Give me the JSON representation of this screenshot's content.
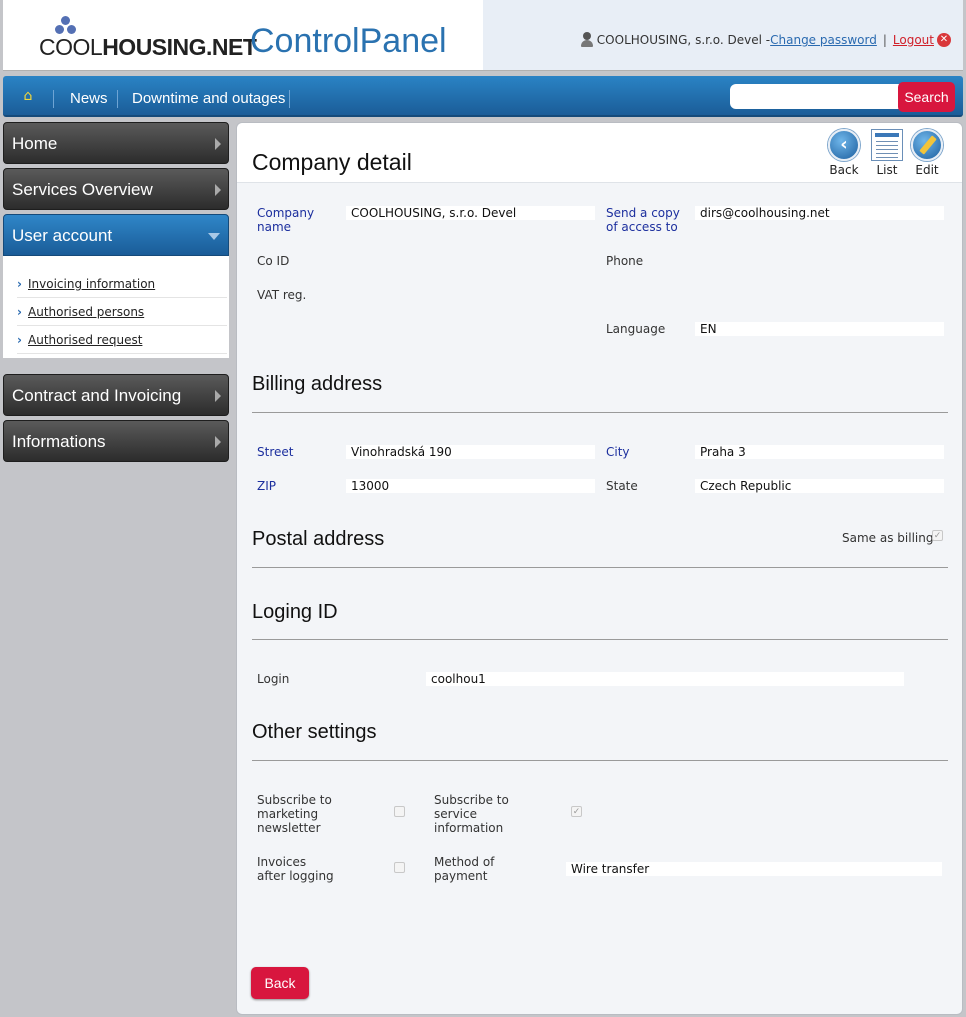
{
  "header": {
    "logo_cool": "COOL",
    "logo_housing": "HOUSING.NET",
    "app_title": "ControlPanel",
    "user_name": "COOLHOUSING, s.r.o. Devel -",
    "change_password": "Change password",
    "separator": "|",
    "logout": "Logout"
  },
  "nav": {
    "items": [
      "News",
      "Downtime and outages"
    ],
    "search_placeholder": "",
    "search_label": "Search"
  },
  "sidebar": {
    "home": "Home",
    "services": "Services Overview",
    "user_account": "User account",
    "sub_items": [
      "Invoicing information",
      "Authorised persons",
      "Authorised request"
    ],
    "contract": "Contract and Invoicing",
    "informations": "Informations"
  },
  "toolbar": {
    "back": "Back",
    "list": "List",
    "edit": "Edit"
  },
  "company": {
    "title": "Company detail",
    "company_name_label": "Company name",
    "company_name_value": "COOLHOUSING, s.r.o. Devel",
    "copy_label": "Send a copy of access to",
    "copy_value": "dirs@coolhousing.net",
    "coid_label": "Co ID",
    "phone_label": "Phone",
    "vat_label": "VAT reg.",
    "language_label": "Language",
    "language_value": "EN"
  },
  "billing": {
    "title": "Billing address",
    "street_label": "Street",
    "street_value": "Vinohradská 190",
    "city_label": "City",
    "city_value": "Praha 3",
    "zip_label": "ZIP",
    "zip_value": "13000",
    "state_label": "State",
    "state_value": "Czech Republic"
  },
  "postal": {
    "title": "Postal address",
    "same_as_billing": "Same as billing",
    "same_checked": true
  },
  "login": {
    "title": "Loging ID",
    "login_label": "Login",
    "login_value": "coolhou1"
  },
  "other": {
    "title": "Other settings",
    "marketing_label": "Subscribe to marketing newsletter",
    "marketing_checked": false,
    "service_label": "Subscribe to service information",
    "service_checked": true,
    "invoices_label": "Invoices after logging",
    "invoices_checked": false,
    "payment_label": "Method of payment",
    "payment_value": "Wire transfer"
  },
  "footer": {
    "back_button": "Back"
  },
  "colors": {
    "accent_blue": "#2a72b0",
    "button_red": "#d8163e",
    "label_blue": "#1c2f9e"
  }
}
